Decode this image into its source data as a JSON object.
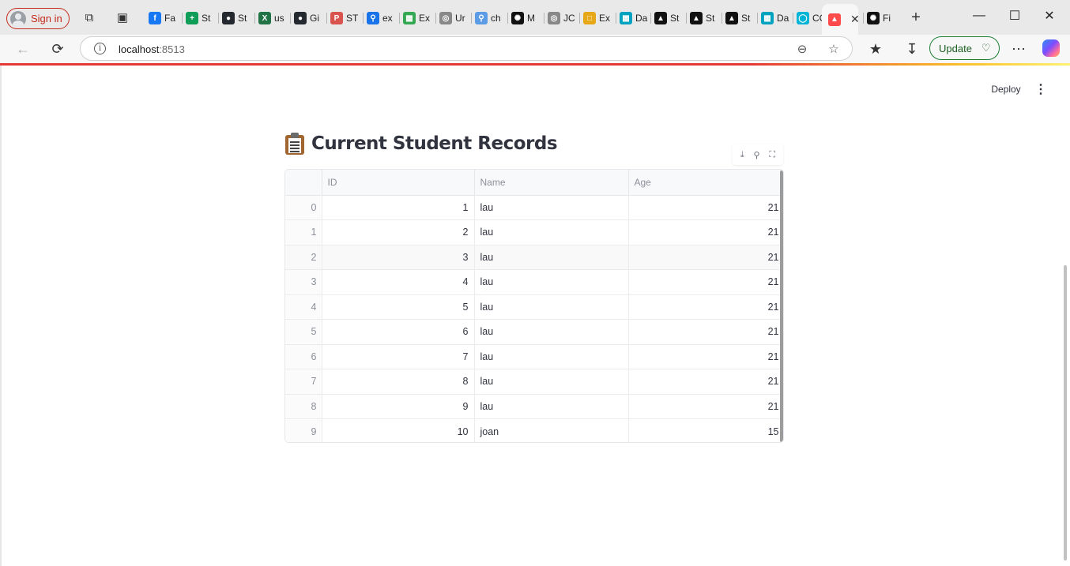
{
  "browser": {
    "sign_in_label": "Sign in",
    "tabs": [
      {
        "label": "Fa",
        "icon": "facebook-icon",
        "color": "#1877f2"
      },
      {
        "label": "St",
        "icon": "sheets-icon",
        "color": "#0f9d58"
      },
      {
        "label": "St",
        "icon": "github-icon",
        "color": "#24292f"
      },
      {
        "label": "us",
        "icon": "excel-icon",
        "color": "#217346"
      },
      {
        "label": "Gi",
        "icon": "github-icon",
        "color": "#24292f"
      },
      {
        "label": "ST",
        "icon": "pdf-icon",
        "color": "#d9534f"
      },
      {
        "label": "ex",
        "icon": "search-icon",
        "color": "#1a73e8"
      },
      {
        "label": "Ex",
        "icon": "sheet-icon",
        "color": "#34a853"
      },
      {
        "label": "Ur",
        "icon": "globe-icon",
        "color": "#888888"
      },
      {
        "label": "ch",
        "icon": "search-icon",
        "color": "#5c9ce6"
      },
      {
        "label": "M",
        "icon": "openai-icon",
        "color": "#111111"
      },
      {
        "label": "JC",
        "icon": "globe-icon",
        "color": "#888888"
      },
      {
        "label": "Ex",
        "icon": "folder-icon",
        "color": "#e6a817"
      },
      {
        "label": "Da",
        "icon": "table-icon",
        "color": "#00a3bf"
      },
      {
        "label": "St",
        "icon": "streamlit-icon",
        "color": "#111111"
      },
      {
        "label": "St",
        "icon": "streamlit-icon",
        "color": "#111111"
      },
      {
        "label": "St",
        "icon": "streamlit-icon",
        "color": "#111111"
      },
      {
        "label": "Da",
        "icon": "table-icon",
        "color": "#00a3bf"
      },
      {
        "label": "CC",
        "icon": "copilot-icon",
        "color": "#00b4d8"
      },
      {
        "label": "",
        "icon": "streamlit-icon",
        "color": "#ff4b4b",
        "active": true
      },
      {
        "label": "Fi",
        "icon": "openai-icon",
        "color": "#111111"
      }
    ],
    "url_host": "localhost",
    "url_port": ":8513",
    "update_label": "Update"
  },
  "app": {
    "deploy_label": "Deploy",
    "title": "Current Student Records",
    "columns": [
      "ID",
      "Name",
      "Age"
    ],
    "rows": [
      {
        "index": "0",
        "id": "1",
        "name": "lau",
        "age": "21"
      },
      {
        "index": "1",
        "id": "2",
        "name": "lau",
        "age": "21"
      },
      {
        "index": "2",
        "id": "3",
        "name": "lau",
        "age": "21"
      },
      {
        "index": "3",
        "id": "4",
        "name": "lau",
        "age": "21"
      },
      {
        "index": "4",
        "id": "5",
        "name": "lau",
        "age": "21"
      },
      {
        "index": "5",
        "id": "6",
        "name": "lau",
        "age": "21"
      },
      {
        "index": "6",
        "id": "7",
        "name": "lau",
        "age": "21"
      },
      {
        "index": "7",
        "id": "8",
        "name": "lau",
        "age": "21"
      },
      {
        "index": "8",
        "id": "9",
        "name": "lau",
        "age": "21"
      },
      {
        "index": "9",
        "id": "10",
        "name": "joan",
        "age": "15"
      }
    ]
  }
}
